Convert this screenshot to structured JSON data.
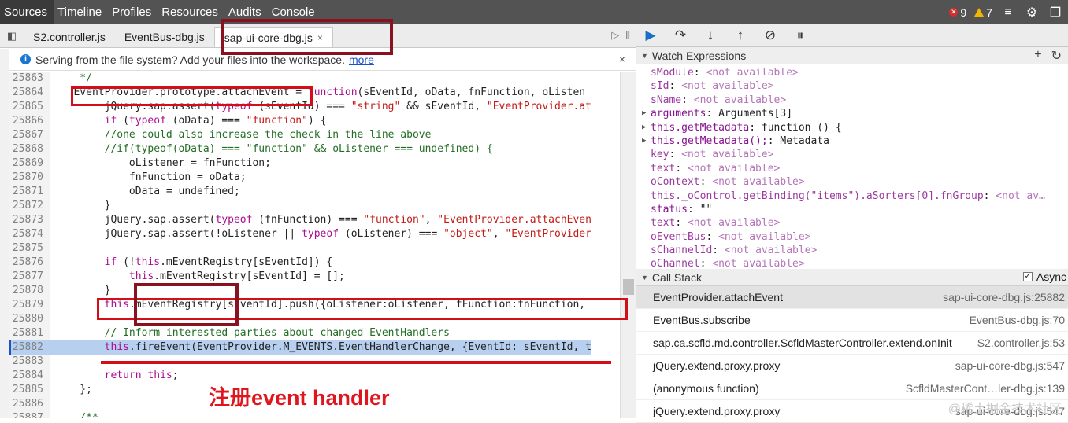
{
  "menubar": {
    "items": [
      "Sources",
      "Timeline",
      "Profiles",
      "Resources",
      "Audits",
      "Console"
    ],
    "error_count": "9",
    "warning_count": "7"
  },
  "tabs": {
    "items": [
      {
        "label": "S2.controller.js"
      },
      {
        "label": "EventBus-dbg.js"
      },
      {
        "label": "sap-ui-core-dbg.js"
      }
    ],
    "close_icon": "×"
  },
  "infobar": {
    "text": "Serving from the file system? Add your files into the workspace.",
    "link": "more",
    "close": "×"
  },
  "code_lines": [
    {
      "n": "25863",
      "segs": [
        [
          "    */",
          "cm"
        ]
      ]
    },
    {
      "n": "25864",
      "segs": [
        [
          "   EventProvider.prototype.attachEvent = ",
          ""
        ],
        [
          "function",
          "kw"
        ],
        [
          "(sEventId, oData, fnFunction, oListen",
          ""
        ]
      ]
    },
    {
      "n": "25865",
      "segs": [
        [
          "        jQuery.sap.assert(",
          ""
        ],
        [
          "typeof",
          "kw"
        ],
        [
          " (sEventId) === ",
          ""
        ],
        [
          "\"string\"",
          "str"
        ],
        [
          " && sEventId, ",
          ""
        ],
        [
          "\"EventProvider.at",
          "str"
        ]
      ]
    },
    {
      "n": "25866",
      "segs": [
        [
          "        ",
          ""
        ],
        [
          "if",
          "kw"
        ],
        [
          " (",
          ""
        ],
        [
          "typeof",
          "kw"
        ],
        [
          " (oData) === ",
          ""
        ],
        [
          "\"function\"",
          "str"
        ],
        [
          ") {",
          ""
        ]
      ]
    },
    {
      "n": "25867",
      "segs": [
        [
          "        //one could also increase the check in the line above",
          "cm"
        ]
      ]
    },
    {
      "n": "25868",
      "segs": [
        [
          "        //if(typeof(oData) === \"function\" && oListener === undefined) {",
          "cm"
        ]
      ]
    },
    {
      "n": "25869",
      "segs": [
        [
          "            oListener = fnFunction;",
          ""
        ]
      ]
    },
    {
      "n": "25870",
      "segs": [
        [
          "            fnFunction = oData;",
          ""
        ]
      ]
    },
    {
      "n": "25871",
      "segs": [
        [
          "            oData = undefined;",
          ""
        ]
      ]
    },
    {
      "n": "25872",
      "segs": [
        [
          "        }",
          ""
        ]
      ]
    },
    {
      "n": "25873",
      "segs": [
        [
          "        jQuery.sap.assert(",
          ""
        ],
        [
          "typeof",
          "kw"
        ],
        [
          " (fnFunction) === ",
          ""
        ],
        [
          "\"function\"",
          "str"
        ],
        [
          ", ",
          ""
        ],
        [
          "\"EventProvider.attachEven",
          "str"
        ]
      ]
    },
    {
      "n": "25874",
      "segs": [
        [
          "        jQuery.sap.assert(!oListener || ",
          ""
        ],
        [
          "typeof",
          "kw"
        ],
        [
          " (oListener) === ",
          ""
        ],
        [
          "\"object\"",
          "str"
        ],
        [
          ", ",
          ""
        ],
        [
          "\"EventProvider",
          "str"
        ]
      ]
    },
    {
      "n": "25875",
      "segs": [
        [
          "",
          ""
        ]
      ]
    },
    {
      "n": "25876",
      "segs": [
        [
          "        ",
          ""
        ],
        [
          "if",
          "kw"
        ],
        [
          " (!",
          ""
        ],
        [
          "this",
          "kw"
        ],
        [
          ".mEventRegistry[sEventId]) {",
          ""
        ]
      ]
    },
    {
      "n": "25877",
      "segs": [
        [
          "            ",
          ""
        ],
        [
          "this",
          "kw"
        ],
        [
          ".mEventRegistry[sEventId] = [];",
          ""
        ]
      ]
    },
    {
      "n": "25878",
      "segs": [
        [
          "        }",
          ""
        ]
      ]
    },
    {
      "n": "25879",
      "segs": [
        [
          "        ",
          ""
        ],
        [
          "this",
          "kw"
        ],
        [
          ".mEventRegistry[sEventId].push({oListener:oListener, fFunction:fnFunction,",
          ""
        ]
      ]
    },
    {
      "n": "25880",
      "segs": [
        [
          "",
          ""
        ]
      ]
    },
    {
      "n": "25881",
      "segs": [
        [
          "        // Inform interested parties about changed EventHandlers",
          "cm"
        ]
      ]
    },
    {
      "n": "25882",
      "segs": [
        [
          "        ",
          ""
        ],
        [
          "this",
          "kw"
        ],
        [
          ".fireEvent(EventProvider.M_EVENTS.EventHandlerChange, {EventId: sEventId, t",
          ""
        ]
      ],
      "hl": true
    },
    {
      "n": "25883",
      "segs": [
        [
          "",
          ""
        ]
      ]
    },
    {
      "n": "25884",
      "segs": [
        [
          "        ",
          ""
        ],
        [
          "return",
          "kw"
        ],
        [
          " ",
          ""
        ],
        [
          "this",
          "kw"
        ],
        [
          ";",
          ""
        ]
      ]
    },
    {
      "n": "25885",
      "segs": [
        [
          "    };",
          ""
        ]
      ]
    },
    {
      "n": "25886",
      "segs": [
        [
          "",
          ""
        ]
      ]
    },
    {
      "n": "25887",
      "segs": [
        [
          "    /**",
          "cm"
        ]
      ]
    }
  ],
  "annotation": "注册event handler",
  "watch": {
    "title": "Watch Expressions",
    "rows": [
      {
        "name": "sModule",
        "val": "<not available>",
        "na": true
      },
      {
        "name": "sId",
        "val": "<not available>",
        "na": true
      },
      {
        "name": "sName",
        "val": "<not available>",
        "na": true
      },
      {
        "name": "arguments",
        "val": "Arguments[3]",
        "na": false,
        "tri": true
      },
      {
        "name": "this.getMetadata",
        "val": "function () {",
        "na": false,
        "tri": true
      },
      {
        "name": "this.getMetadata();",
        "val": "Metadata",
        "na": false,
        "tri": true
      },
      {
        "name": "key",
        "val": "<not available>",
        "na": true
      },
      {
        "name": "text",
        "val": "<not available>",
        "na": true
      },
      {
        "name": "oContext",
        "val": "<not available>",
        "na": true
      },
      {
        "name": "this._oControl.getBinding(\"items\").aSorters[0].fnGroup",
        "val": "<not av…",
        "na": true
      },
      {
        "name": "status",
        "val": "\"\"",
        "na": false
      },
      {
        "name": "text",
        "val": "<not available>",
        "na": true
      },
      {
        "name": "oEventBus",
        "val": "<not available>",
        "na": true
      },
      {
        "name": "sChannelId",
        "val": "<not available>",
        "na": true
      },
      {
        "name": "oChannel",
        "val": "<not available>",
        "na": true
      }
    ]
  },
  "callstack": {
    "title": "Call Stack",
    "async_label": "Async",
    "rows": [
      {
        "fn": "EventProvider.attachEvent",
        "loc": "sap-ui-core-dbg.js:25882"
      },
      {
        "fn": "EventBus.subscribe",
        "loc": "EventBus-dbg.js:70"
      },
      {
        "fn": "sap.ca.scfld.md.controller.ScfldMasterController.extend.onInit",
        "loc": "S2.controller.js:53"
      },
      {
        "fn": "jQuery.extend.proxy.proxy",
        "loc": "sap-ui-core-dbg.js:547"
      },
      {
        "fn": "(anonymous function)",
        "loc": "ScfldMasterCont…ler-dbg.js:139"
      },
      {
        "fn": "jQuery.extend.proxy.proxy",
        "loc": "sap-ui-core-dbg.js:547"
      }
    ]
  },
  "watermark": "@稀土掘金技术社区"
}
